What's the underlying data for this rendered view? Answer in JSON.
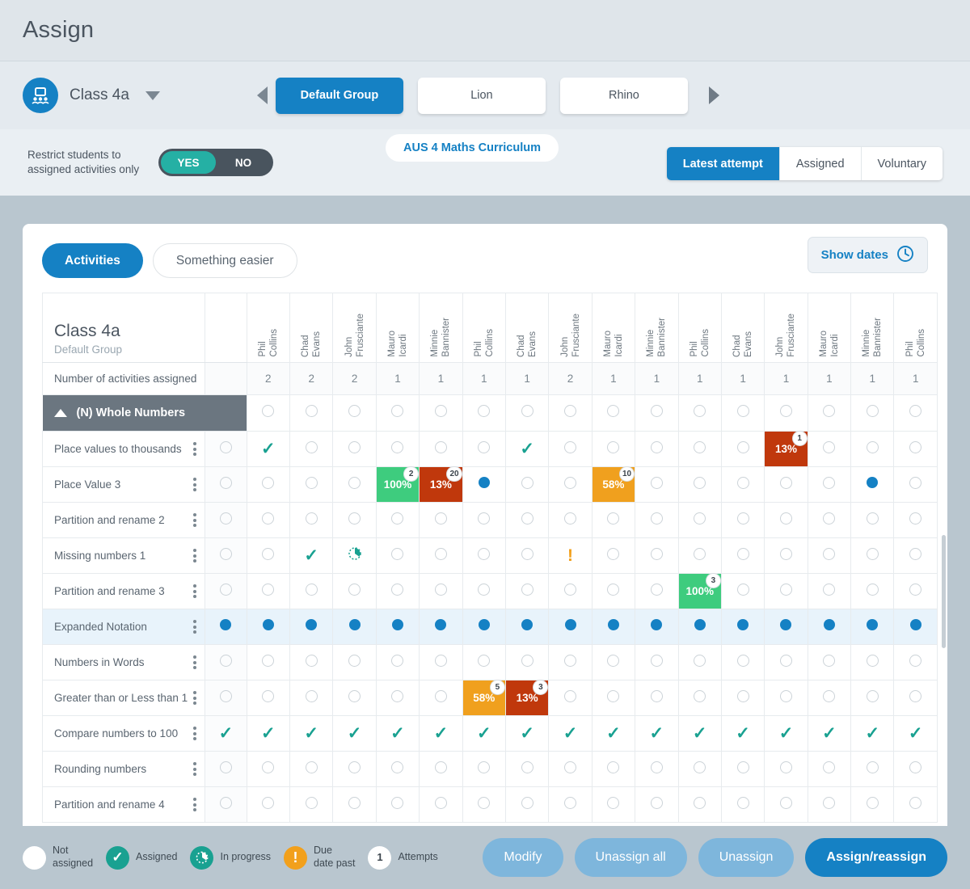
{
  "header": {
    "title": "Assign"
  },
  "class_selector": {
    "icon": "classroom-icon",
    "name": "Class 4a",
    "dropdown_icon": "chevron-down-icon"
  },
  "group_tabs": {
    "prev_icon": "arrow-left-icon",
    "next_icon": "arrow-right-icon",
    "items": [
      {
        "label": "Default Group",
        "active": true
      },
      {
        "label": "Lion",
        "active": false
      },
      {
        "label": "Rhino",
        "active": false
      }
    ]
  },
  "curriculum": {
    "label": "AUS 4 Maths Curriculum"
  },
  "restrict": {
    "label_line1": "Restrict students to",
    "label_line2": "assigned activities only",
    "yes": "YES",
    "no": "NO",
    "selected": "YES"
  },
  "view_tabs": [
    {
      "label": "Latest attempt",
      "active": true
    },
    {
      "label": "Assigned",
      "active": false
    },
    {
      "label": "Voluntary",
      "active": false
    }
  ],
  "card_tabs": [
    {
      "label": "Activities",
      "active": true
    },
    {
      "label": "Something easier",
      "active": false
    }
  ],
  "show_dates": {
    "label": "Show dates",
    "icon": "clock-icon"
  },
  "table": {
    "title": "Class 4a",
    "subtitle": "Default Group",
    "count_row_label": "Number of activities assigned",
    "students": [
      "Phil Collins",
      "Chad Evans",
      "John Frusciante",
      "Mauro Icardi",
      "Minnie Bannister",
      "Phil Collins",
      "Chad Evans",
      "John Frusciante",
      "Mauro Icardi",
      "Minnie Bannister",
      "Phil Collins",
      "Chad Evans",
      "John Frusciante",
      "Mauro Icardi",
      "Minnie Bannister",
      "Phil Collins"
    ],
    "counts": [
      2,
      2,
      2,
      1,
      1,
      1,
      1,
      2,
      1,
      1,
      1,
      1,
      1,
      1,
      1,
      1
    ],
    "section": {
      "label": "(N) Whole Numbers",
      "collapse_icon": "triangle-up-icon"
    },
    "rows": [
      {
        "label": "Place values to thousands",
        "select": "empty",
        "highlight": false,
        "cells": [
          "check",
          "empty",
          "empty",
          "empty",
          "empty",
          "empty",
          "check",
          "empty",
          "empty",
          "empty",
          "empty",
          "empty",
          {
            "type": "badge",
            "pct": "13%",
            "attempts": "1",
            "color": "#c0380c"
          },
          "empty",
          "empty",
          "empty"
        ]
      },
      {
        "label": "Place Value 3",
        "select": "empty",
        "highlight": false,
        "cells": [
          "empty",
          "empty",
          "empty",
          {
            "type": "badge",
            "pct": "100%",
            "attempts": "2",
            "color": "#3ecc7e"
          },
          {
            "type": "badge",
            "pct": "13%",
            "attempts": "20",
            "color": "#c0380c"
          },
          "dot",
          "empty",
          "empty",
          {
            "type": "badge",
            "pct": "58%",
            "attempts": "10",
            "color": "#f0a01e"
          },
          "empty",
          "empty",
          "empty",
          "empty",
          "empty",
          "dot",
          "empty"
        ]
      },
      {
        "label": "Partition and rename 2",
        "select": "empty",
        "highlight": false,
        "cells": [
          "empty",
          "empty",
          "empty",
          "empty",
          "empty",
          "empty",
          "empty",
          "empty",
          "empty",
          "empty",
          "empty",
          "empty",
          "empty",
          "empty",
          "empty",
          "empty"
        ]
      },
      {
        "label": "Missing numbers 1",
        "select": "empty",
        "highlight": false,
        "cells": [
          "empty",
          "check",
          "pie",
          "empty",
          "empty",
          "empty",
          "empty",
          "bang",
          "empty",
          "empty",
          "empty",
          "empty",
          "empty",
          "empty",
          "empty",
          "empty"
        ]
      },
      {
        "label": "Partition and rename 3",
        "select": "empty",
        "highlight": false,
        "cells": [
          "empty",
          "empty",
          "empty",
          "empty",
          "empty",
          "empty",
          "empty",
          "empty",
          "empty",
          "empty",
          {
            "type": "badge",
            "pct": "100%",
            "attempts": "3",
            "color": "#3ecc7e"
          },
          "empty",
          "empty",
          "empty",
          "empty",
          "empty"
        ]
      },
      {
        "label": "Expanded Notation",
        "select": "dot",
        "highlight": true,
        "cells": [
          "dot",
          "dot",
          "dot",
          "dot",
          "dot",
          "dot",
          "dot",
          "dot",
          "dot",
          "dot",
          "dot",
          "dot",
          "dot",
          "dot",
          "dot",
          "dot"
        ]
      },
      {
        "label": "Numbers in Words",
        "select": "empty",
        "highlight": false,
        "cells": [
          "empty",
          "empty",
          "empty",
          "empty",
          "empty",
          "empty",
          "empty",
          "empty",
          "empty",
          "empty",
          "empty",
          "empty",
          "empty",
          "empty",
          "empty",
          "empty"
        ]
      },
      {
        "label": "Greater than or Less than 1",
        "select": "empty",
        "highlight": false,
        "cells": [
          "empty",
          "empty",
          "empty",
          "empty",
          "empty",
          {
            "type": "badge",
            "pct": "58%",
            "attempts": "5",
            "color": "#f0a01e"
          },
          {
            "type": "badge",
            "pct": "13%",
            "attempts": "3",
            "color": "#c0380c"
          },
          "empty",
          "empty",
          "empty",
          "empty",
          "empty",
          "empty",
          "empty",
          "empty",
          "empty"
        ]
      },
      {
        "label": "Compare numbers to 100",
        "select": "check",
        "highlight": false,
        "cells": [
          "check",
          "check",
          "check",
          "check",
          "check",
          "check",
          "check",
          "check",
          "check",
          "check",
          "check",
          "check",
          "check",
          "check",
          "check",
          "check"
        ]
      },
      {
        "label": "Rounding numbers",
        "select": "empty",
        "highlight": false,
        "cells": [
          "empty",
          "empty",
          "empty",
          "empty",
          "empty",
          "empty",
          "empty",
          "empty",
          "empty",
          "empty",
          "empty",
          "empty",
          "empty",
          "empty",
          "empty",
          "empty"
        ]
      },
      {
        "label": "Partition and rename 4",
        "select": "empty",
        "highlight": false,
        "cells": [
          "empty",
          "empty",
          "empty",
          "empty",
          "empty",
          "empty",
          "empty",
          "empty",
          "empty",
          "empty",
          "empty",
          "empty",
          "empty",
          "empty",
          "empty",
          "empty"
        ]
      }
    ]
  },
  "legend": [
    {
      "icon": "empty-circle-icon",
      "line1": "Not",
      "line2": "assigned"
    },
    {
      "icon": "check-circle-icon",
      "line1": "Assigned",
      "line2": ""
    },
    {
      "icon": "pie-circle-icon",
      "line1": "In progress",
      "line2": ""
    },
    {
      "icon": "exclamation-circle-icon",
      "line1": "Due",
      "line2": "date past"
    },
    {
      "icon": "attempts-badge-icon",
      "line1": "Attempts",
      "line2": "",
      "value": "1"
    }
  ],
  "actions": [
    {
      "label": "Modify",
      "style": "muted"
    },
    {
      "label": "Unassign all",
      "style": "muted"
    },
    {
      "label": "Unassign",
      "style": "muted"
    },
    {
      "label": "Assign/reassign",
      "style": "solid"
    }
  ],
  "colors": {
    "brand_blue": "#1581c4",
    "teal": "#19a191",
    "green": "#3ecc7e",
    "orange": "#f0a01e",
    "dark_red": "#c0380c",
    "section_gray": "#6b7680"
  }
}
